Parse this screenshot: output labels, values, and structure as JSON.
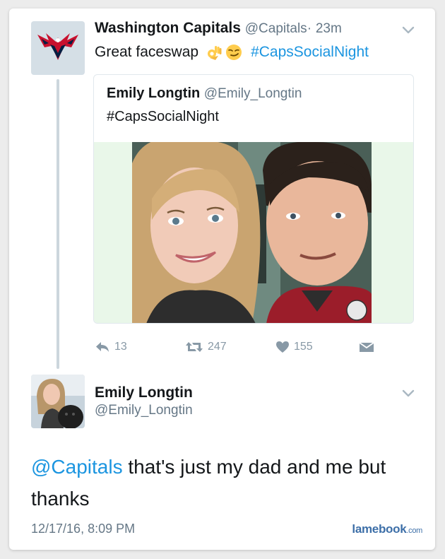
{
  "tweet1": {
    "author_name": "Washington Capitals",
    "author_handle": "@Capitals",
    "separator": "·",
    "time_ago": "23m",
    "text": "Great faceswap",
    "emojis": [
      "ok-hand-emoji",
      "smirk-emoji"
    ],
    "hashtag": "#CapsSocialNight",
    "avatar_icon": "capitals-eagle-logo",
    "quoted": {
      "author_name": "Emily Longtin",
      "author_handle": "@Emily_Longtin",
      "text": "#CapsSocialNight",
      "media": "selfie-photo"
    },
    "actions": {
      "reply_icon": "reply-icon",
      "reply_count": "13",
      "retweet_icon": "retweet-icon",
      "retweet_count": "247",
      "like_icon": "heart-icon",
      "like_count": "155",
      "dm_icon": "direct-message-icon"
    }
  },
  "tweet2": {
    "author_name": "Emily Longtin",
    "author_handle": "@Emily_Longtin",
    "mention": "@Capitals",
    "text": " that's just my dad and me but thanks",
    "timestamp": "12/17/16, 8:09 PM"
  },
  "watermark": {
    "brand": "lamebook",
    "suffix": ".com"
  },
  "colors": {
    "link": "#1b95e0",
    "secondary_text": "#657786",
    "icon_gray": "#8899a6",
    "thread_line": "#ccd6dd",
    "media_background": "#e9f7e9",
    "watermark": "#3d6fa8"
  }
}
